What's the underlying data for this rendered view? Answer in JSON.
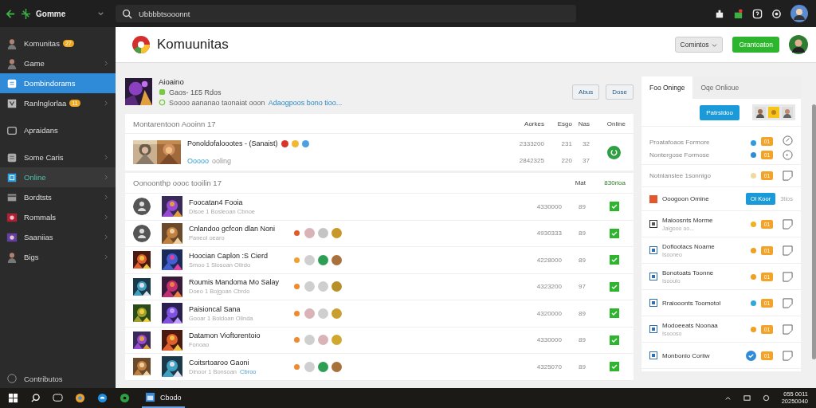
{
  "topbar": {
    "app_name": "Gomme",
    "search": {
      "value": "Ubbbbtsooonnt"
    }
  },
  "sidebar": {
    "items": [
      {
        "label": "Komunitas",
        "badge": "27",
        "expandable": false,
        "selected": false,
        "highlighted": false
      },
      {
        "label": "Game",
        "expandable": true,
        "selected": false,
        "highlighted": false
      },
      {
        "label": "Dombindorams",
        "expandable": false,
        "selected": true,
        "highlighted": false
      },
      {
        "label": "Ranlnglorlaa",
        "badge": "11",
        "expandable": true,
        "selected": false,
        "highlighted": false
      },
      {
        "label": "Apraidans",
        "expandable": false,
        "selected": false,
        "highlighted": false
      },
      {
        "label": "Some Caris",
        "expandable": true,
        "selected": false,
        "highlighted": false
      },
      {
        "label": "Online",
        "expandable": true,
        "selected": false,
        "highlighted": true
      },
      {
        "label": "Bordtsts",
        "expandable": true,
        "selected": false,
        "highlighted": false
      },
      {
        "label": "Rommals",
        "expandable": true,
        "selected": false,
        "highlighted": false
      },
      {
        "label": "Saaniias",
        "expandable": true,
        "selected": false,
        "highlighted": false
      },
      {
        "label": "Bigs",
        "expandable": true,
        "selected": false,
        "highlighted": false
      }
    ],
    "footer": "Contributos"
  },
  "header": {
    "title": "Komuunitas",
    "filter_button": "Comintos",
    "primary_button": "Grantoaton"
  },
  "profile": {
    "name": "Aioaino",
    "stats": "Gaos- 1£5  Rdos",
    "description": "Soooo aananao taonaiat ooon",
    "description_link": "Adaogpoos bono tioo...",
    "buttons": [
      "Abus",
      "Dose"
    ]
  },
  "featured": {
    "title": "Montarentoon Aooinn 17",
    "columns": [
      "Aorkes",
      "Esgo",
      "Nas",
      "Online"
    ],
    "row": {
      "name": "Ponoldofaloootes - (Sanaist)",
      "status_link": "Ooooo",
      "status_text": "ooling",
      "lines": [
        [
          "2333200",
          "231",
          "32"
        ],
        [
          "2842325",
          "220",
          "37"
        ]
      ],
      "online": true,
      "badges": [
        {
          "color": "#d8342a"
        },
        {
          "color": "#f2b930"
        },
        {
          "color": "#4aa0e0"
        }
      ]
    }
  },
  "list": {
    "title": "Oonoonthp oooc tooilin 17",
    "columns": [
      "Mat",
      "830rloa"
    ],
    "rows": [
      {
        "avatar": {
          "kind": "person"
        },
        "name": "Foocatan4 Fooia",
        "sub": "Disoe 1 Bosleoan Cbnoe",
        "value": "4330000",
        "mat": "89",
        "checked": true,
        "badges": []
      },
      {
        "avatar": {
          "kind": "person"
        },
        "name": "Cnlandoo gcfcon dlan Noni",
        "sub": "Paneol oearo",
        "value": "4930333",
        "mat": "89",
        "checked": true,
        "badges": [
          {
            "color": "#e05a2a"
          },
          {
            "color": "#d9b3b8"
          },
          {
            "color": "#c4c4c4"
          },
          {
            "color": "#c9962a"
          }
        ]
      },
      {
        "name": "Hoocian Caplon :S Cierd",
        "sub": "Smoo 1 Slosoan Olirdo",
        "value": "4228000",
        "mat": "89",
        "checked": true,
        "badges": [
          {
            "color": "#f0a030"
          },
          {
            "color": "#cfcfcf"
          },
          {
            "color": "#2e9e55"
          },
          {
            "color": "#a8703a"
          }
        ]
      },
      {
        "name": "Roumis Mandoma Mo Salay",
        "sub": "Doeo 1 Bojgoan Cbrdo",
        "value": "4323200",
        "mat": "97",
        "checked": true,
        "badges": [
          {
            "color": "#f08a30"
          },
          {
            "color": "#cfcfcf"
          },
          {
            "color": "#cfcfcf"
          },
          {
            "color": "#b8902a"
          }
        ]
      },
      {
        "name": "Paisioncal Sana",
        "sub": "Gooar 1 Boldoan Olinda",
        "value": "4320000",
        "mat": "89",
        "checked": true,
        "badges": [
          {
            "color": "#f08a30"
          },
          {
            "color": "#d9b3b8"
          },
          {
            "color": "#cfcfcf"
          },
          {
            "color": "#c9a030"
          }
        ]
      },
      {
        "name": "Datamon Vioftorentoio",
        "sub": "Fonoao",
        "value": "4330000",
        "mat": "89",
        "checked": true,
        "badges": [
          {
            "color": "#f08a30"
          },
          {
            "color": "#cfcfcf"
          },
          {
            "color": "#d9b3b8"
          },
          {
            "color": "#d0a830"
          }
        ]
      },
      {
        "name": "Coitsrtoaroo Gaoni",
        "sub": "Dinoor 1 Bonsoan",
        "sub_link": "Cbroo",
        "value": "4325070",
        "mat": "89",
        "checked": true,
        "badges": [
          {
            "color": "#f08a30"
          },
          {
            "color": "#cfcfcf"
          },
          {
            "color": "#2e9e55"
          },
          {
            "color": "#a8703a"
          }
        ]
      }
    ]
  },
  "panel": {
    "tabs": [
      {
        "label": "Foo Oninge",
        "selected": true
      },
      {
        "label": "Oqe Onlioue",
        "selected": false
      }
    ],
    "button": "Patrsldoo",
    "rows": [
      {
        "kind": "simple",
        "label": "Proatafoaos  Formore",
        "color": "#2f9ae0",
        "pill": "01",
        "action": {
          "kind": "check"
        },
        "done": false
      },
      {
        "kind": "simple",
        "label": "Nontergose  Formose",
        "color": "#2f8ad8",
        "pill": "01",
        "action": {
          "kind": "circle"
        },
        "done": false
      },
      {
        "kind": "simple",
        "label": "Notnlanslee 1sonnigo",
        "color": "#f0d8a0",
        "pill": "01",
        "action": {
          "kind": "note"
        },
        "done": false
      },
      {
        "kind": "header",
        "label": "Ooogoon Omine",
        "button": "Ol Koor",
        "text": "3tios"
      },
      {
        "kind": "item",
        "label": "Maloosnts Morme",
        "sub": "Jaigooo oo...",
        "color": "#f0b020",
        "pill": "01",
        "action": {
          "kind": "note"
        },
        "done": false
      },
      {
        "kind": "item",
        "label": "Doflootacs Noame",
        "sub": "Isooneo",
        "color": "#f0a020",
        "pill": "01",
        "action": {
          "kind": "note"
        },
        "done": false
      },
      {
        "kind": "item",
        "label": "Bonotoats Toonne",
        "sub": "Isooulo",
        "color": "#f0a020",
        "pill": "01",
        "action": {
          "kind": "note"
        },
        "done": false
      },
      {
        "kind": "item",
        "label": "Rraiooonts Toomotol",
        "color": "#30a8d8",
        "pill": "01",
        "action": {
          "kind": "note"
        },
        "done": false
      },
      {
        "kind": "item",
        "label": "Modoeeats Noonaa",
        "sub": "Isoooso",
        "color": "#f0a020",
        "pill": "01",
        "action": {
          "kind": "note"
        },
        "done": false
      },
      {
        "kind": "item",
        "label": "Monbonlo Coriiw",
        "pill": "01",
        "action": {
          "kind": "note"
        },
        "done": true
      }
    ]
  },
  "taskbar": {
    "app_label": "Cbodo",
    "clock_time": "055 0011",
    "clock_date": "20250040"
  }
}
